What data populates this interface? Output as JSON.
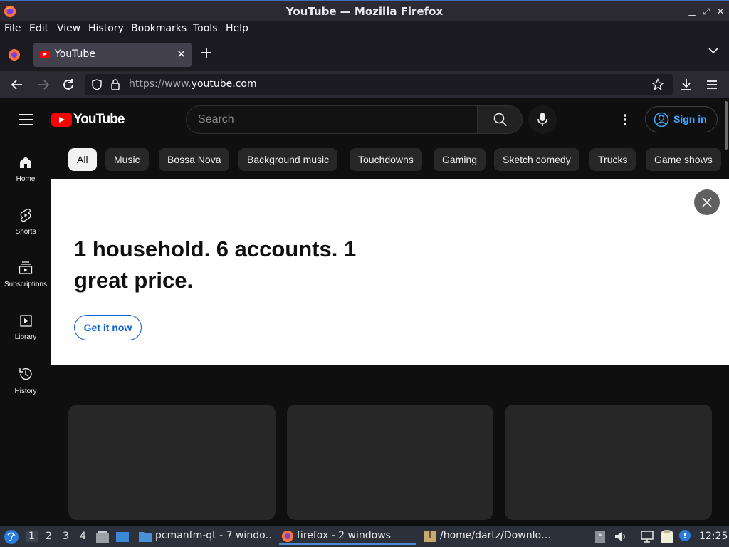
{
  "window": {
    "title": "YouTube — Mozilla Firefox"
  },
  "menubar": {
    "items": [
      "File",
      "Edit",
      "View",
      "History",
      "Bookmarks",
      "Tools",
      "Help"
    ]
  },
  "tabs": [
    {
      "title": "YouTube",
      "favicon": "youtube-favicon"
    }
  ],
  "navbar": {
    "url_prefix": "https://www.",
    "url_domain": "youtube.com"
  },
  "youtube": {
    "logo_text": "YouTube",
    "search_placeholder": "Search",
    "sign_in": "Sign in",
    "leftnav": [
      {
        "label": "Home",
        "icon": "home-icon"
      },
      {
        "label": "Shorts",
        "icon": "shorts-icon"
      },
      {
        "label": "Subscriptions",
        "icon": "subscriptions-icon"
      },
      {
        "label": "Library",
        "icon": "library-icon"
      },
      {
        "label": "History",
        "icon": "history-icon"
      }
    ],
    "chips": [
      "All",
      "Music",
      "Bossa Nova",
      "Background music",
      "Touchdowns",
      "Gaming",
      "Sketch comedy",
      "Trucks",
      "Game shows"
    ],
    "banner": {
      "headline": "1 household. 6 accounts. 1 great price.",
      "cta": "Get it now"
    },
    "colors": {
      "brand_red": "#ff0000",
      "link_blue": "#3ea6ff",
      "cta_blue": "#065fd4"
    }
  },
  "taskbar": {
    "workspaces": [
      "1",
      "2",
      "3",
      "4"
    ],
    "tasks": [
      {
        "label": "pcmanfm-qt - 7 windo…",
        "icon": "folder-icon"
      },
      {
        "label": "firefox - 2 windows",
        "icon": "firefox-icon"
      },
      {
        "label": "/home/dartz/Downlo…",
        "icon": "archive-icon"
      }
    ],
    "clock": "12:25"
  }
}
